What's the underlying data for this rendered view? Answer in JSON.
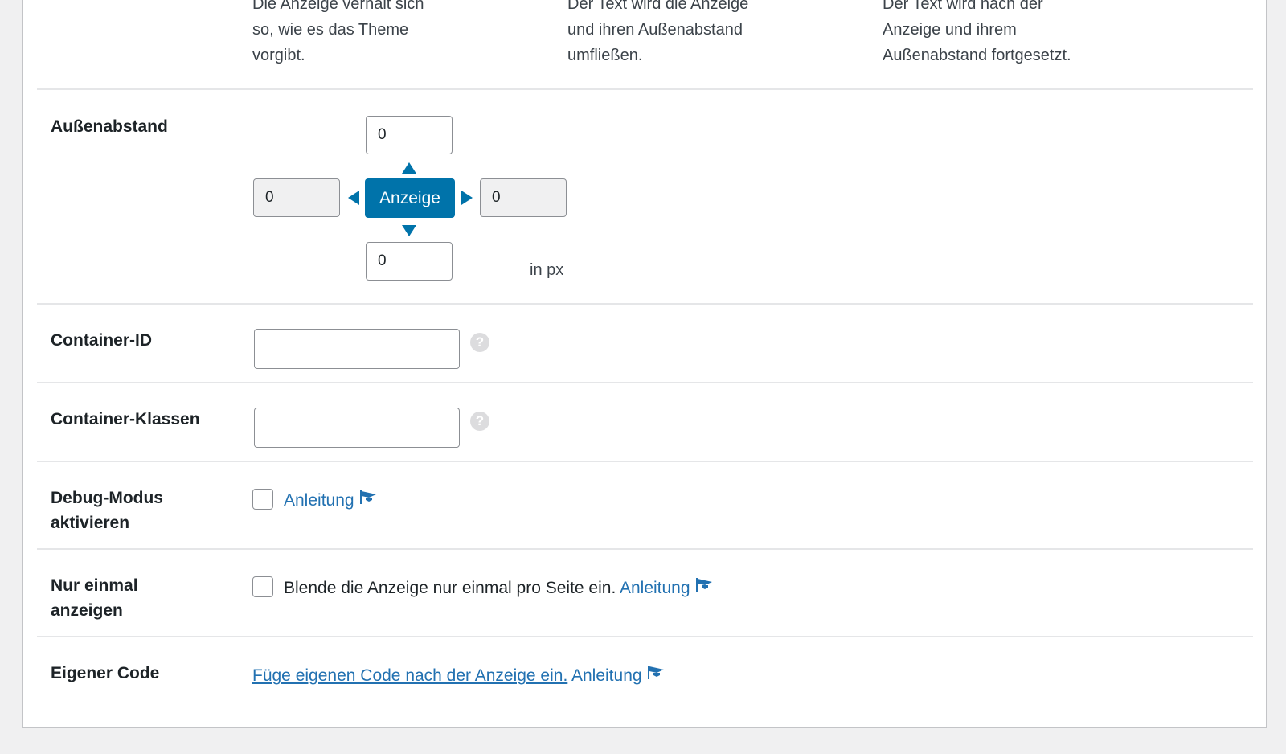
{
  "positions": {
    "default": {
      "lines": [
        "Die Anzeige verhält sich",
        "so, wie es das Theme",
        "vorgibt."
      ]
    },
    "float": {
      "lines": [
        "Der Text wird die Anzeige",
        "und ihren Außenabstand",
        "umfließen."
      ]
    },
    "block": {
      "lines": [
        "Der Text wird nach der",
        "Anzeige und ihrem",
        "Außenabstand fortgesetzt."
      ]
    }
  },
  "margin": {
    "label": "Außenabstand",
    "top": "0",
    "left": "0",
    "right": "0",
    "bottom": "0",
    "center_label": "Anzeige",
    "unit": "in px"
  },
  "container_id": {
    "label": "Container-ID",
    "value": "",
    "help": "?"
  },
  "container_classes": {
    "label": "Container-Klassen",
    "value": "",
    "help": "?"
  },
  "debug": {
    "label_line1": "Debug-Modus",
    "label_line2": "aktivieren",
    "link": "Anleitung",
    "checked": false
  },
  "once": {
    "label_line1": "Nur einmal",
    "label_line2": "anzeigen",
    "text": "Blende die Anzeige nur einmal pro Seite ein.",
    "link": "Anleitung",
    "checked": false
  },
  "custom_code": {
    "label": "Eigener Code",
    "add_link": "Füge eigenen Code nach der Anzeige ein.",
    "link": "Anleitung"
  },
  "colors": {
    "accent": "#0073aa",
    "link": "#2271b1"
  },
  "icons": {
    "help": "help-icon",
    "tutorial": "graduation-cap-icon"
  }
}
